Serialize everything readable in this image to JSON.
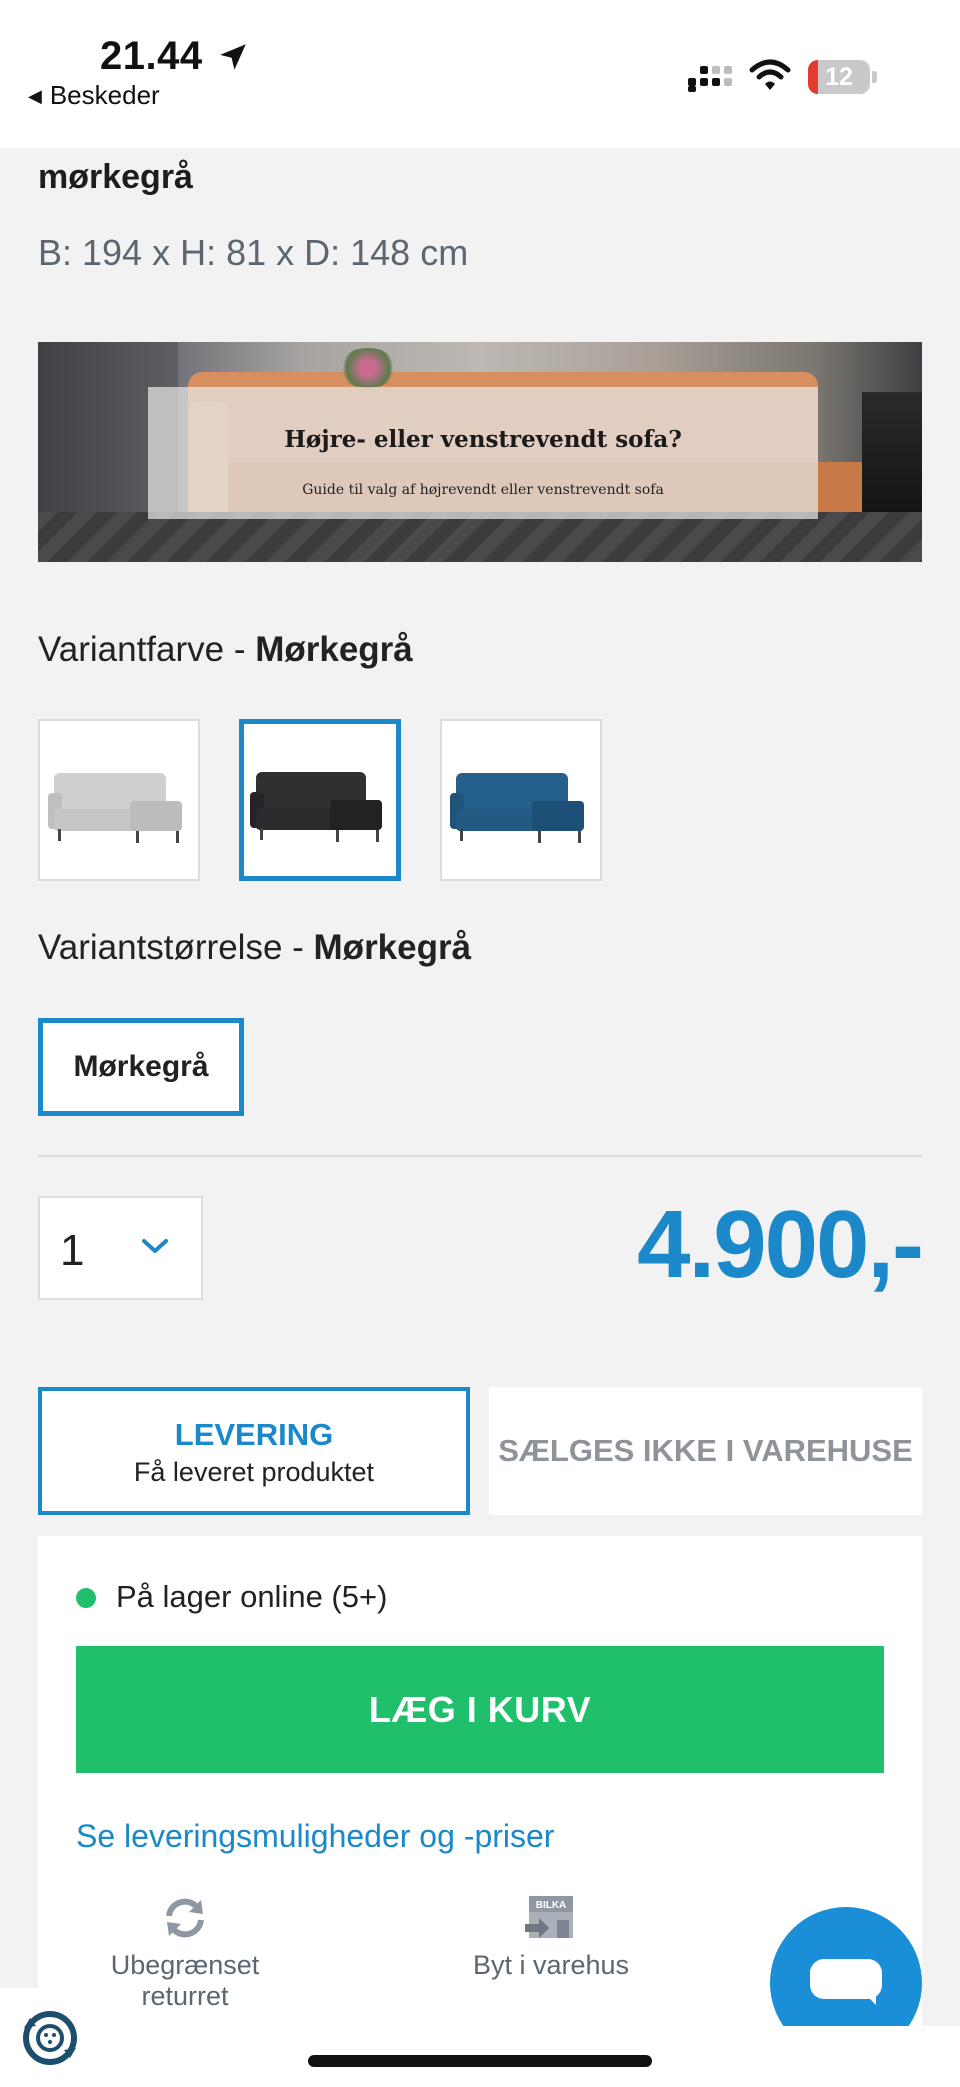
{
  "status_bar": {
    "time": "21.44",
    "back_label": "Beskeder",
    "battery": "12",
    "icons": [
      "location-arrow-icon",
      "signal-icon",
      "wifi-icon",
      "battery-icon"
    ]
  },
  "product": {
    "title_partial": "mørkegrå",
    "dimensions": "B: 194 x H: 81 x D: 148 cm"
  },
  "banner": {
    "heading": "Højre- eller venstrevendt sofa?",
    "subtext": "Guide til valg af højrevendt eller venstrevendt sofa"
  },
  "variant_color": {
    "label": "Variantfarve - ",
    "selected": "Mørkegrå",
    "swatches": [
      {
        "color": "#c9c9c9",
        "selected": false
      },
      {
        "color": "#2b2b2d",
        "selected": true
      },
      {
        "color": "#1f5f8c",
        "selected": false
      }
    ]
  },
  "variant_size": {
    "label": "Variantstørrelse - ",
    "selected": "Mørkegrå",
    "button": "Mørkegrå"
  },
  "quantity": {
    "value": "1"
  },
  "price": "4.900,-",
  "tabs": {
    "delivery_title": "LEVERING",
    "delivery_sub": "Få leveret produktet",
    "store": "SÆLGES IKKE I VAREHUSE"
  },
  "availability": {
    "stock_text": "På lager online (5+)",
    "cart_button": "LÆG I KURV",
    "delivery_link": "Se leveringsmuligheder og -priser",
    "perk_return": "Ubegrænset returret",
    "perk_exchange": "Byt i varehus",
    "exchange_badge": "BILKA"
  },
  "colors": {
    "accent": "#1a88c9",
    "cta": "#1fbf6b",
    "chat": "#1a8fd8"
  }
}
